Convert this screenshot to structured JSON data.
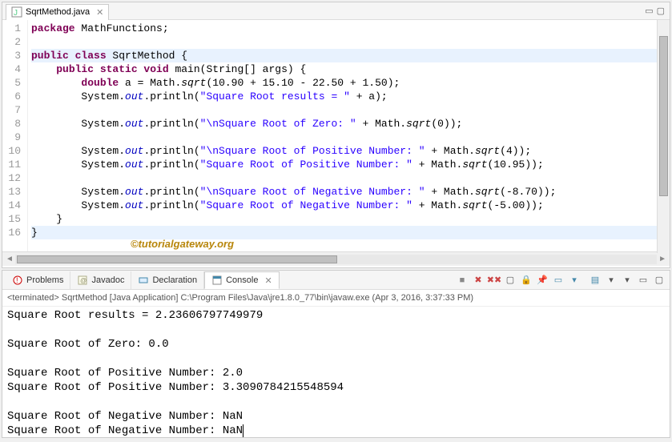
{
  "editor": {
    "tab": {
      "filename": "SqrtMethod.java"
    },
    "lines": [
      {
        "n": "1",
        "html": "<span class='kw'>package</span> MathFunctions;"
      },
      {
        "n": "2",
        "html": ""
      },
      {
        "n": "3",
        "html": "<span class='kw'>public class</span> SqrtMethod {",
        "hl": true
      },
      {
        "n": "4",
        "html": "    <span class='kw'>public static void</span> main(String[] args) {",
        "bp": true
      },
      {
        "n": "5",
        "html": "        <span class='kw'>double</span> a = Math.<span class='method-i'>sqrt</span>(10.90 + 15.10 - 22.50 + 1.50);"
      },
      {
        "n": "6",
        "html": "        System.<span class='field'>out</span>.println(<span class='str'>\"Square Root results = \"</span> + a);"
      },
      {
        "n": "7",
        "html": ""
      },
      {
        "n": "8",
        "html": "        System.<span class='field'>out</span>.println(<span class='str'>\"\\nSquare Root of Zero: \"</span> + Math.<span class='method-i'>sqrt</span>(0));"
      },
      {
        "n": "9",
        "html": ""
      },
      {
        "n": "10",
        "html": "        System.<span class='field'>out</span>.println(<span class='str'>\"\\nSquare Root of Positive Number: \"</span> + Math.<span class='method-i'>sqrt</span>(4));"
      },
      {
        "n": "11",
        "html": "        System.<span class='field'>out</span>.println(<span class='str'>\"Square Root of Positive Number: \"</span> + Math.<span class='method-i'>sqrt</span>(10.95));"
      },
      {
        "n": "12",
        "html": ""
      },
      {
        "n": "13",
        "html": "        System.<span class='field'>out</span>.println(<span class='str'>\"\\nSquare Root of Negative Number: \"</span> + Math.<span class='method-i'>sqrt</span>(-8.70));"
      },
      {
        "n": "14",
        "html": "        System.<span class='field'>out</span>.println(<span class='str'>\"Square Root of Negative Number: \"</span> + Math.<span class='method-i'>sqrt</span>(-5.00));"
      },
      {
        "n": "15",
        "html": "    }"
      },
      {
        "n": "16",
        "html": "}",
        "hl": true
      }
    ],
    "watermark": "©tutorialgateway.org"
  },
  "bottom": {
    "tabs": {
      "problems": "Problems",
      "javadoc": "Javadoc",
      "declaration": "Declaration",
      "console": "Console"
    },
    "terminated": "<terminated> SqrtMethod [Java Application] C:\\Program Files\\Java\\jre1.8.0_77\\bin\\javaw.exe (Apr 3, 2016, 3:37:33 PM)",
    "output": "Square Root results = 2.23606797749979\n\nSquare Root of Zero: 0.0\n\nSquare Root of Positive Number: 2.0\nSquare Root of Positive Number: 3.3090784215548594\n\nSquare Root of Negative Number: NaN\nSquare Root of Negative Number: NaN"
  }
}
